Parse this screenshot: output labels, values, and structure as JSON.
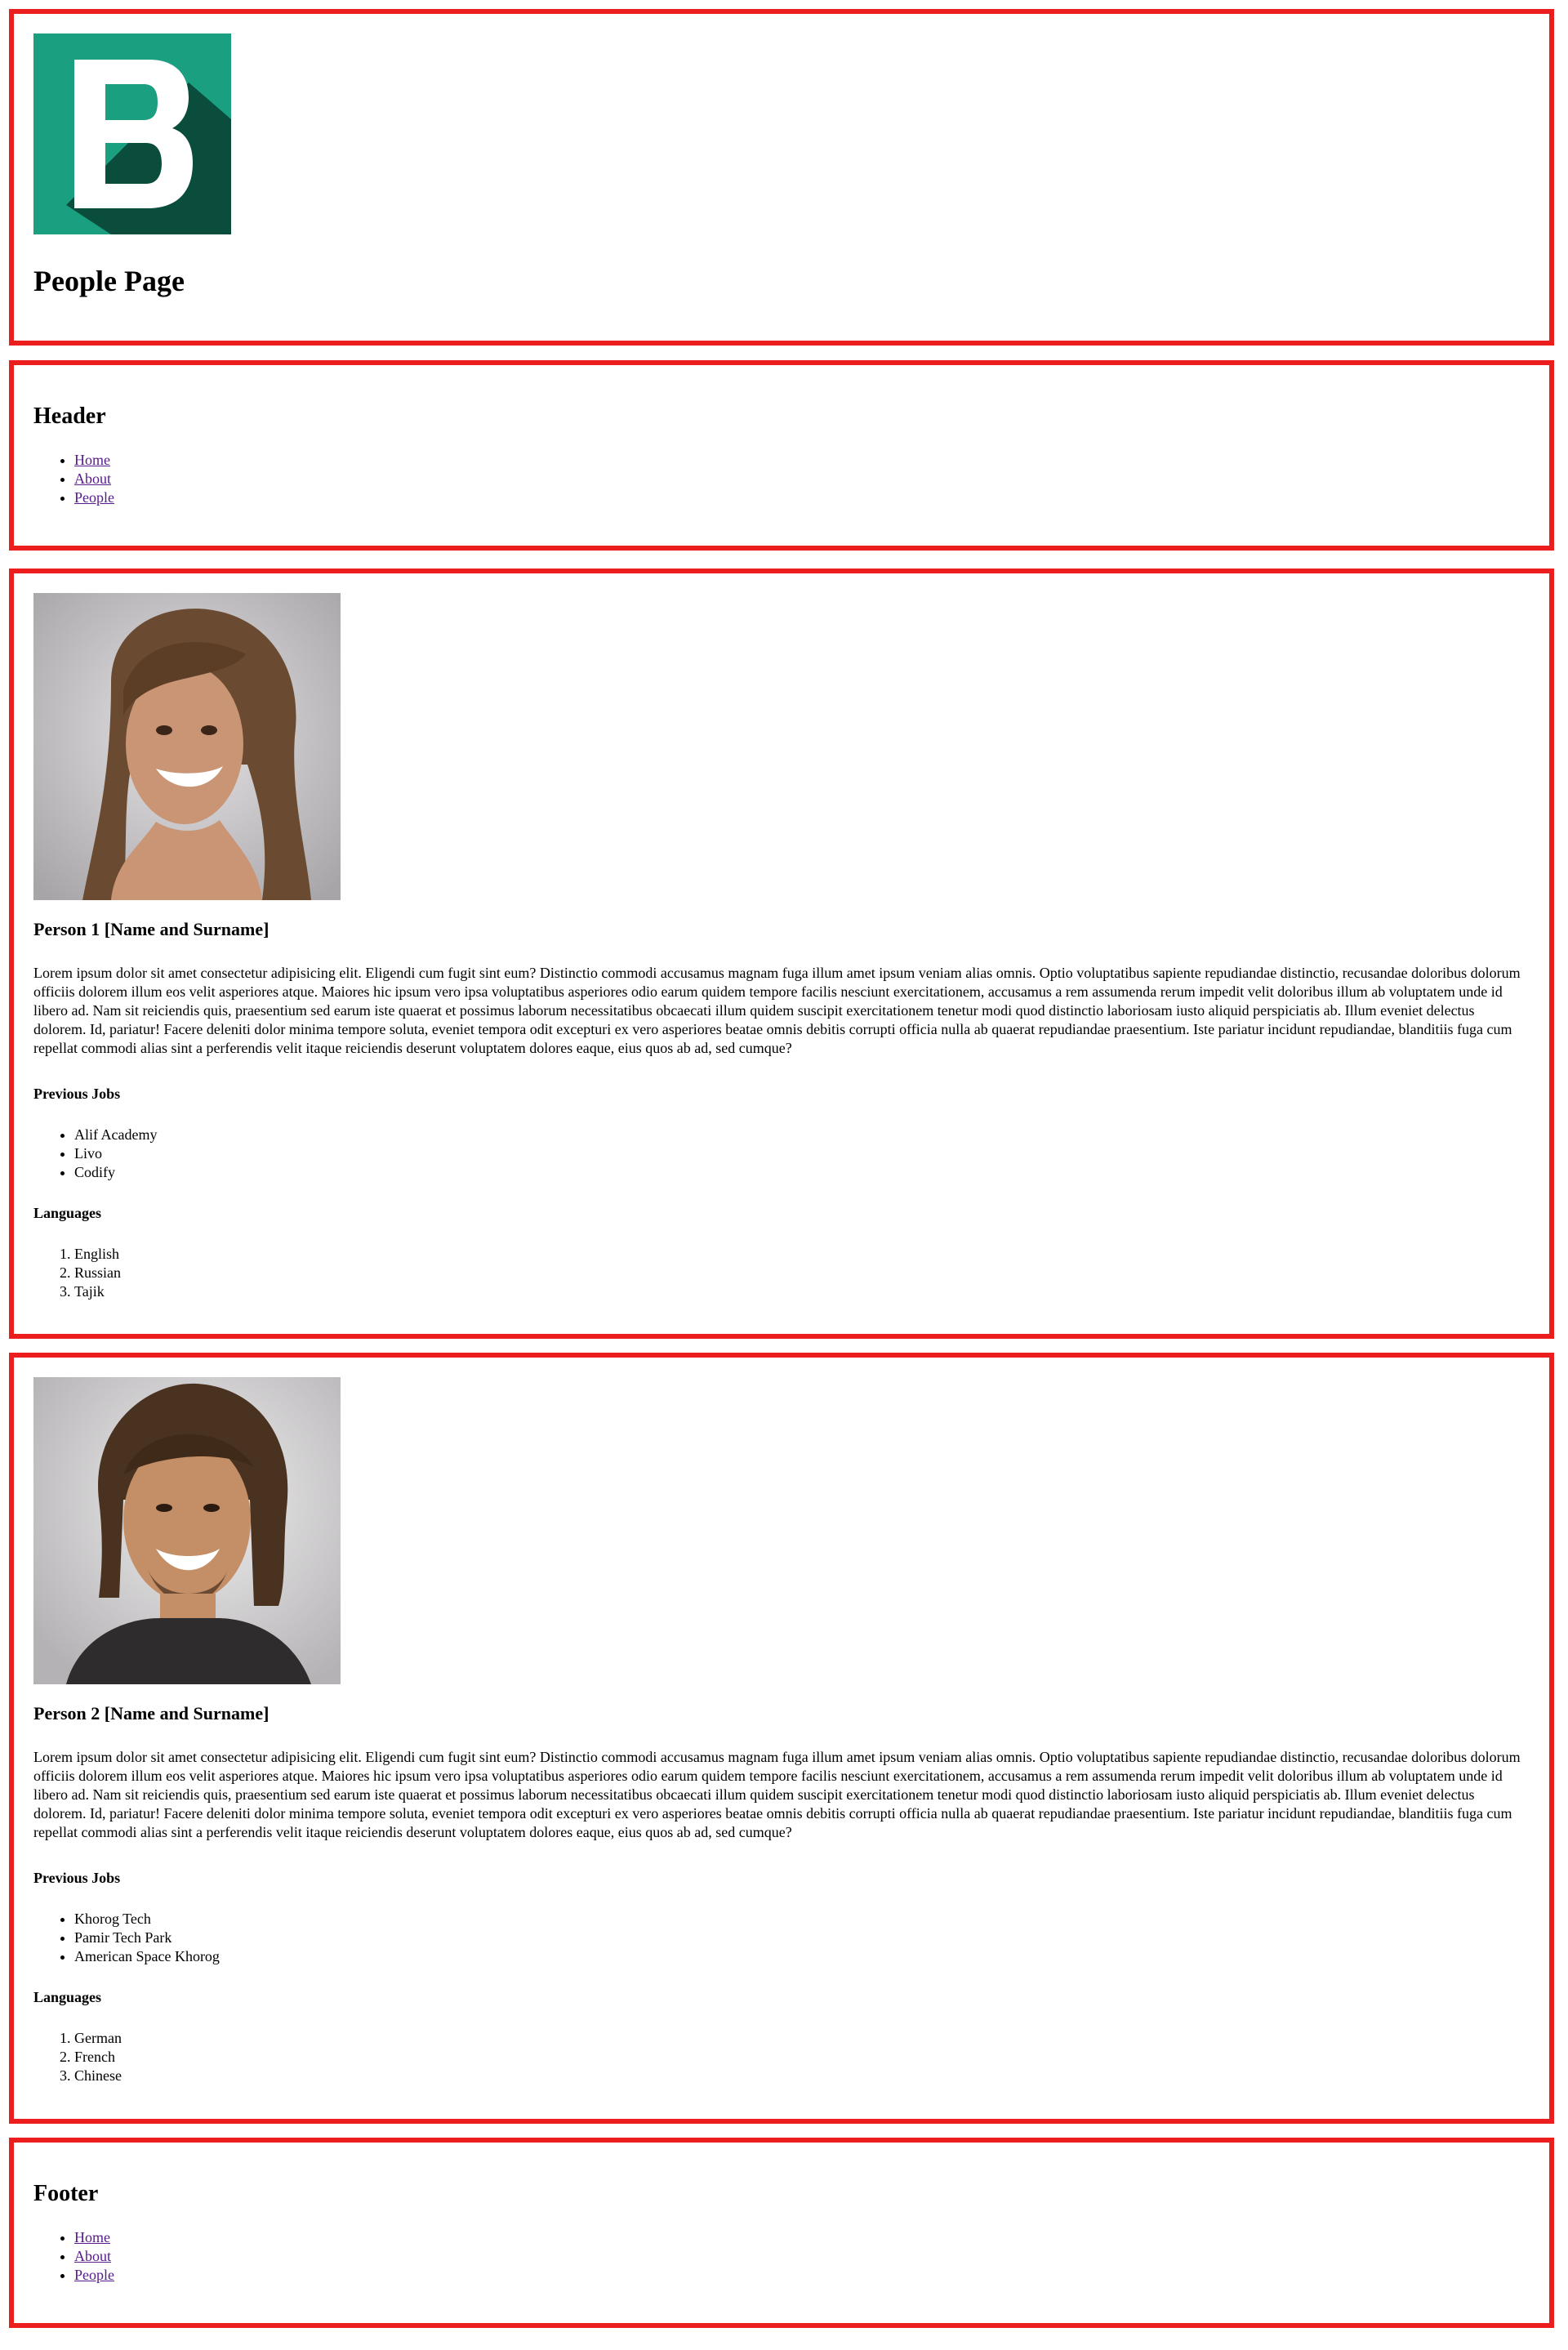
{
  "page": {
    "title": "People Page"
  },
  "header": {
    "title": "Header",
    "nav": [
      "Home",
      "About",
      "People"
    ]
  },
  "people": [
    {
      "name": "Person 1 [Name and Surname]",
      "bio": "Lorem ipsum dolor sit amet consectetur adipisicing elit. Eligendi cum fugit sint eum? Distinctio commodi accusamus magnam fuga illum amet ipsum veniam alias omnis. Optio voluptatibus sapiente repudiandae distinctio, recusandae doloribus dolorum officiis dolorem illum eos velit asperiores atque. Maiores hic ipsum vero ipsa voluptatibus asperiores odio earum quidem tempore facilis nesciunt exercitationem, accusamus a rem assumenda rerum impedit velit doloribus illum ab voluptatem unde id libero ad. Nam sit reiciendis quis, praesentium sed earum iste quaerat et possimus laborum necessitatibus obcaecati illum quidem suscipit exercitationem tenetur modi quod distinctio laboriosam iusto aliquid perspiciatis ab. Illum eveniet delectus dolorem. Id, pariatur! Facere deleniti dolor minima tempore soluta, eveniet tempora odit excepturi ex vero asperiores beatae omnis debitis corrupti officia nulla ab quaerat repudiandae praesentium. Iste pariatur incidunt repudiandae, blanditiis fuga cum repellat commodi alias sint a perferendis velit itaque reiciendis deserunt voluptatem dolores eaque, eius quos ab ad, sed cumque?",
      "jobs_title": "Previous Jobs",
      "jobs": [
        "Alif Academy",
        "Livo",
        "Codify"
      ],
      "languages_title": "Languages",
      "languages": [
        "English",
        "Russian",
        "Tajik"
      ]
    },
    {
      "name": "Person 2 [Name and Surname]",
      "bio": "Lorem ipsum dolor sit amet consectetur adipisicing elit. Eligendi cum fugit sint eum? Distinctio commodi accusamus magnam fuga illum amet ipsum veniam alias omnis. Optio voluptatibus sapiente repudiandae distinctio, recusandae doloribus dolorum officiis dolorem illum eos velit asperiores atque. Maiores hic ipsum vero ipsa voluptatibus asperiores odio earum quidem tempore facilis nesciunt exercitationem, accusamus a rem assumenda rerum impedit velit doloribus illum ab voluptatem unde id libero ad. Nam sit reiciendis quis, praesentium sed earum iste quaerat et possimus laborum necessitatibus obcaecati illum quidem suscipit exercitationem tenetur modi quod distinctio laboriosam iusto aliquid perspiciatis ab. Illum eveniet delectus dolorem. Id, pariatur! Facere deleniti dolor minima tempore soluta, eveniet tempora odit excepturi ex vero asperiores beatae omnis debitis corrupti officia nulla ab quaerat repudiandae praesentium. Iste pariatur incidunt repudiandae, blanditiis fuga cum repellat commodi alias sint a perferendis velit itaque reiciendis deserunt voluptatem dolores eaque, eius quos ab ad, sed cumque?",
      "jobs_title": "Previous Jobs",
      "jobs": [
        "Khorog Tech",
        "Pamir Tech Park",
        "American Space Khorog"
      ],
      "languages_title": "Languages",
      "languages": [
        "German",
        "French",
        "Chinese"
      ]
    }
  ],
  "footer": {
    "title": "Footer",
    "nav": [
      "Home",
      "About",
      "People"
    ]
  },
  "colors": {
    "section_border": "#ec1d1d",
    "visited_link": "#551a8b",
    "logo_light": "#1a9f80",
    "logo_dark": "#0b4d3d"
  }
}
